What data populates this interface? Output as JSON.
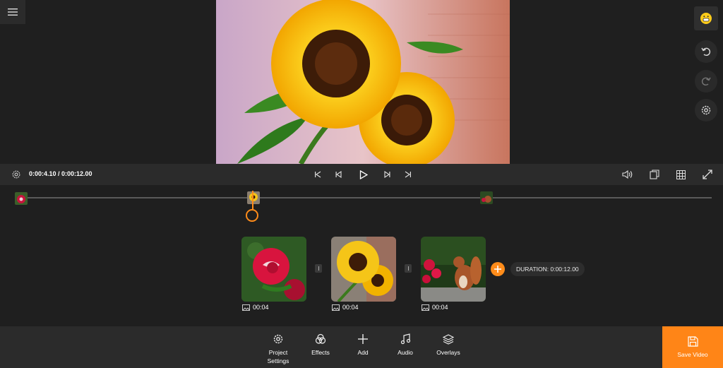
{
  "playback": {
    "time": "0:00:4.10 / 0:00:12.00"
  },
  "clips": [
    {
      "duration": "00:04"
    },
    {
      "duration": "00:04"
    },
    {
      "duration": "00:04"
    }
  ],
  "total_duration": "DURATION: 0:00:12.00",
  "toolbar": {
    "project_settings_line1": "Project",
    "project_settings_line2": "Settings",
    "effects": "Effects",
    "add": "Add",
    "audio": "Audio",
    "overlays": "Overlays",
    "save_video": "Save Video"
  },
  "colors": {
    "accent": "#ff8517",
    "bar": "#2b2b2b",
    "background": "#1f1f1f"
  },
  "icons": [
    "menu-icon",
    "emoji-icon",
    "undo-icon",
    "redo-icon",
    "settings-icon",
    "skip-start-icon",
    "step-back-icon",
    "play-icon",
    "step-forward-icon",
    "skip-end-icon",
    "volume-icon",
    "aspect-ratio-icon",
    "grid-icon",
    "fullscreen-icon",
    "image-icon",
    "plus-icon",
    "effects-icon",
    "music-icon",
    "layers-icon",
    "save-icon"
  ]
}
